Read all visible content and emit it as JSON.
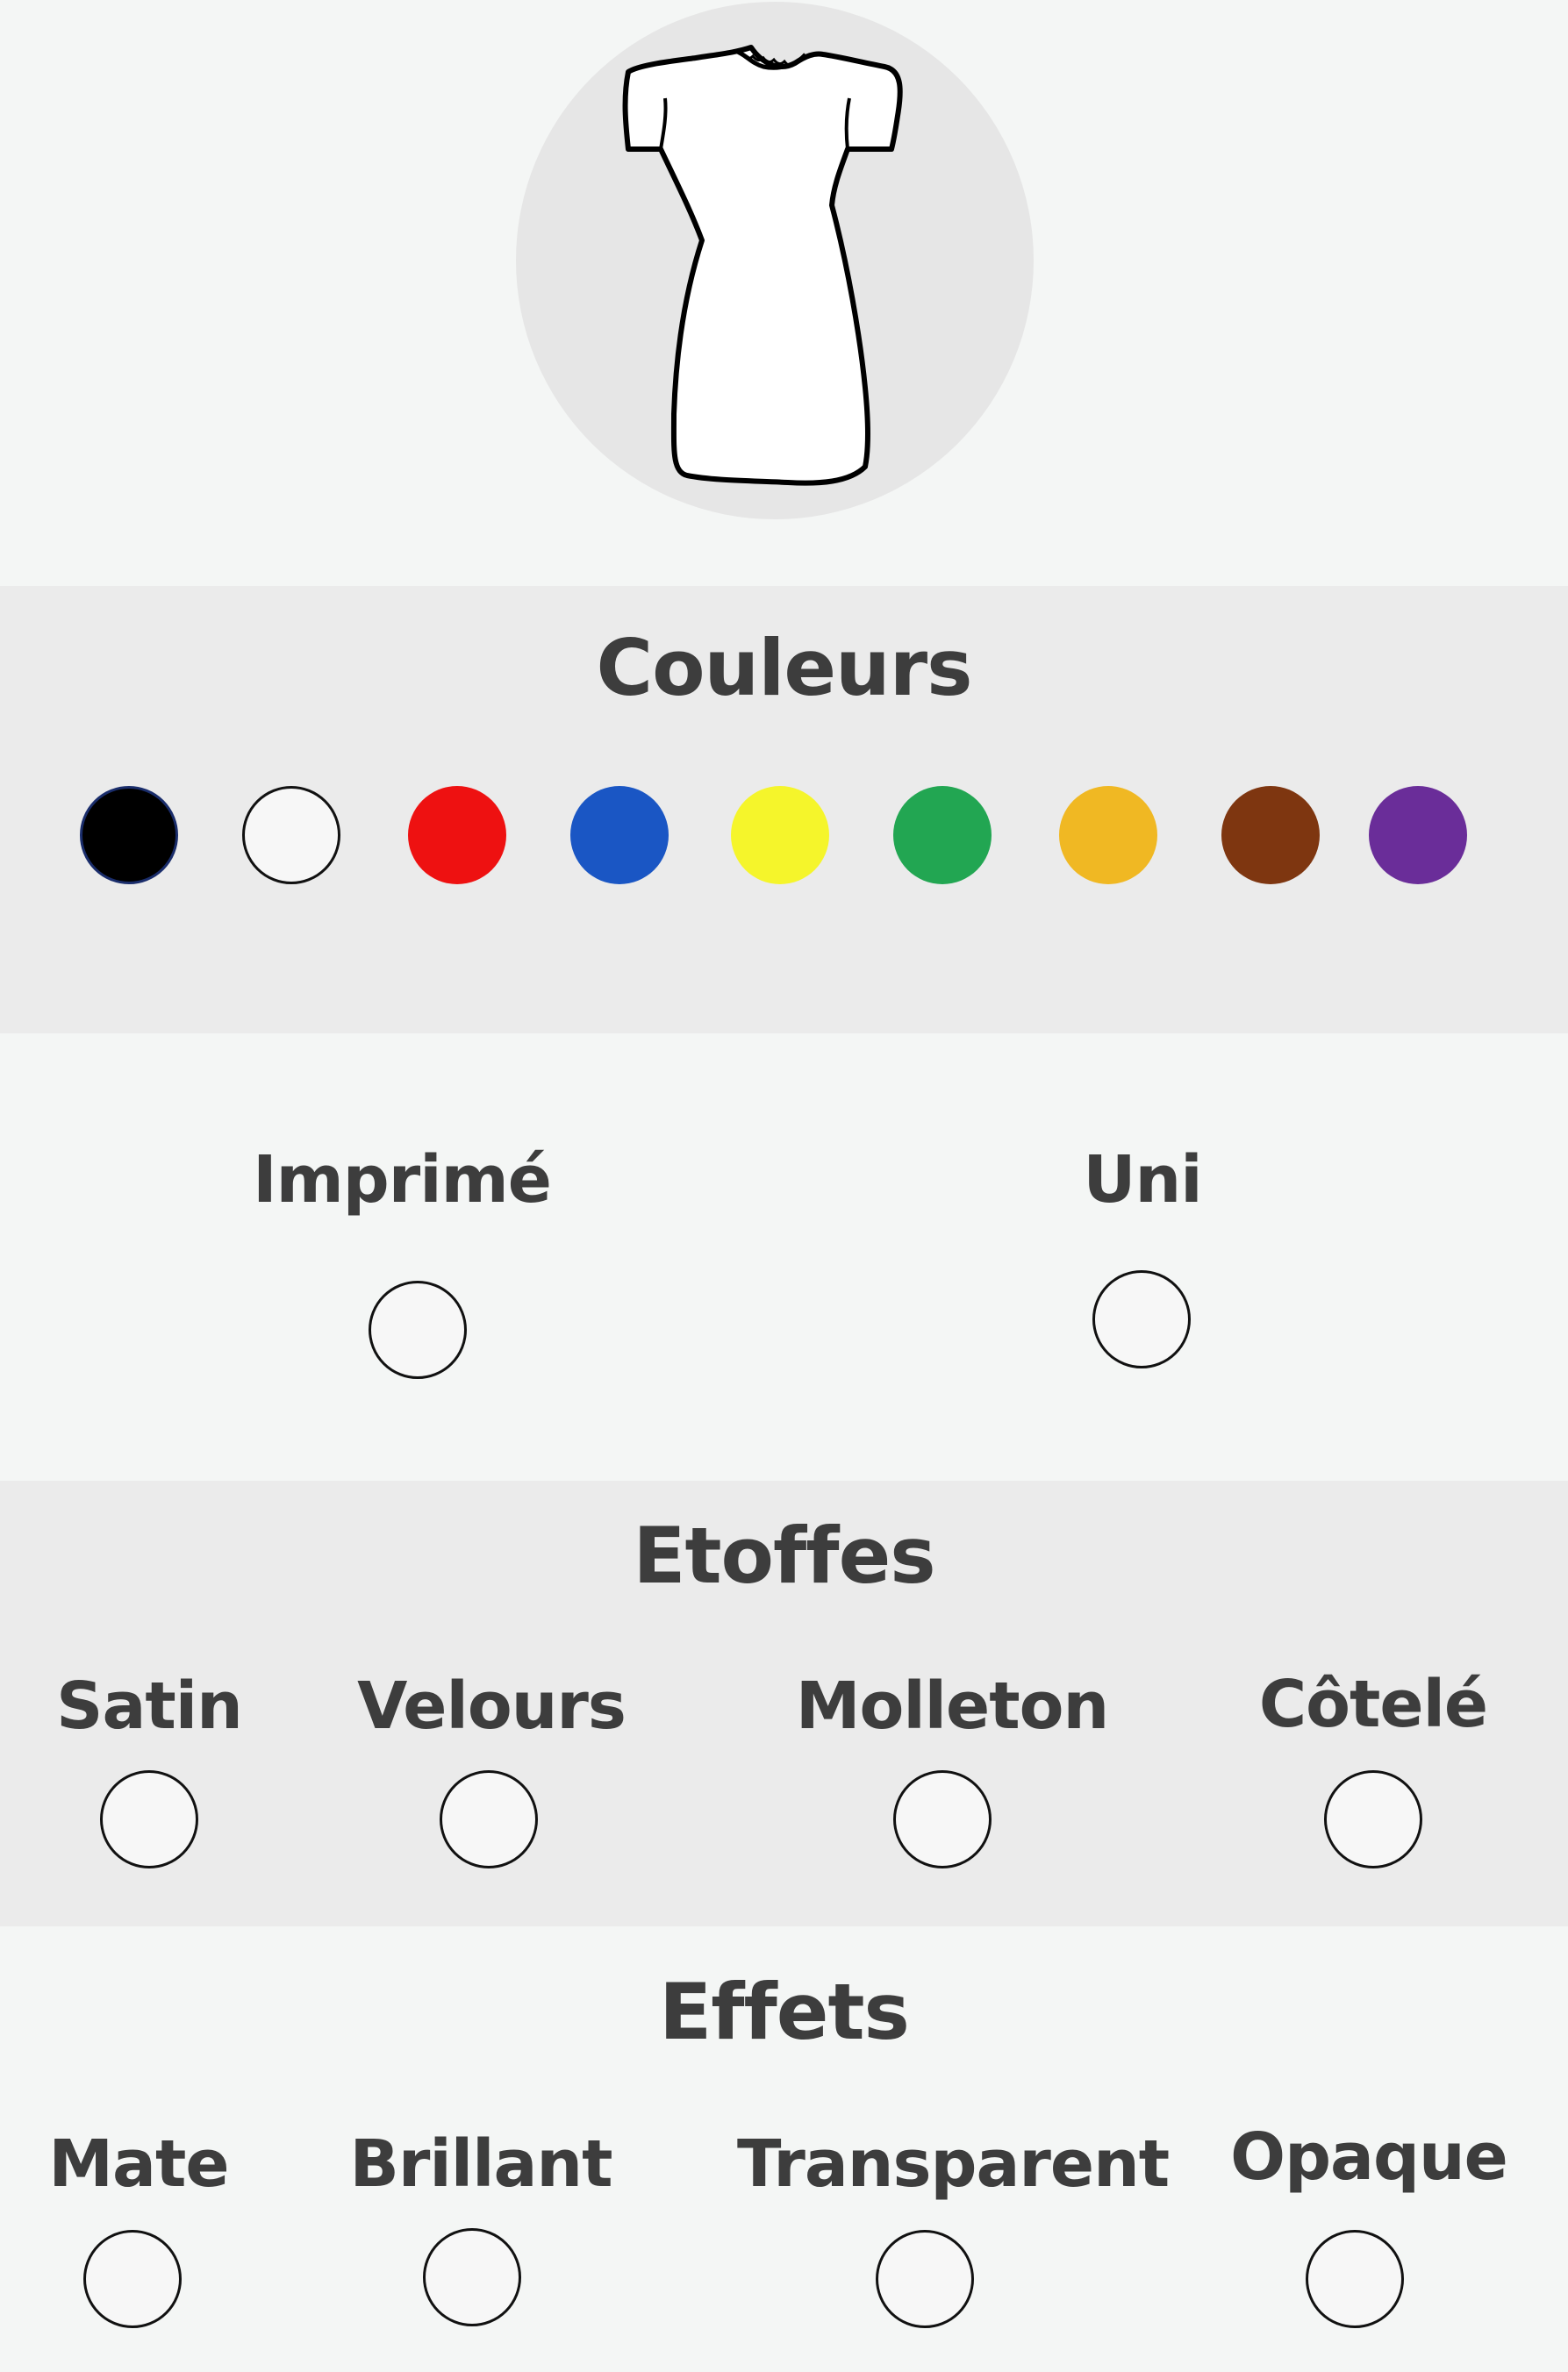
{
  "garment": {
    "icon": "dress-icon"
  },
  "couleurs": {
    "title": "Couleurs",
    "swatches": [
      {
        "name": "black",
        "color": "#000000"
      },
      {
        "name": "white",
        "color": "#f7f7f7"
      },
      {
        "name": "red",
        "color": "#ee1111"
      },
      {
        "name": "blue",
        "color": "#1a56c4"
      },
      {
        "name": "yellow",
        "color": "#f5f52b"
      },
      {
        "name": "green",
        "color": "#22a652"
      },
      {
        "name": "orange",
        "color": "#f0b823"
      },
      {
        "name": "brown",
        "color": "#7e3610"
      },
      {
        "name": "purple",
        "color": "#6a2d99"
      }
    ]
  },
  "motif": {
    "options": [
      {
        "label": "Imprimé"
      },
      {
        "label": "Uni"
      }
    ]
  },
  "etoffes": {
    "title": "Etoffes",
    "options": [
      {
        "label": "Satin"
      },
      {
        "label": "Velours"
      },
      {
        "label": "Molleton"
      },
      {
        "label": "Côtelé"
      }
    ]
  },
  "effets": {
    "title": "Effets",
    "options": [
      {
        "label": "Mate"
      },
      {
        "label": "Brillant"
      },
      {
        "label": "Transparent"
      },
      {
        "label": "Opaque"
      }
    ]
  }
}
